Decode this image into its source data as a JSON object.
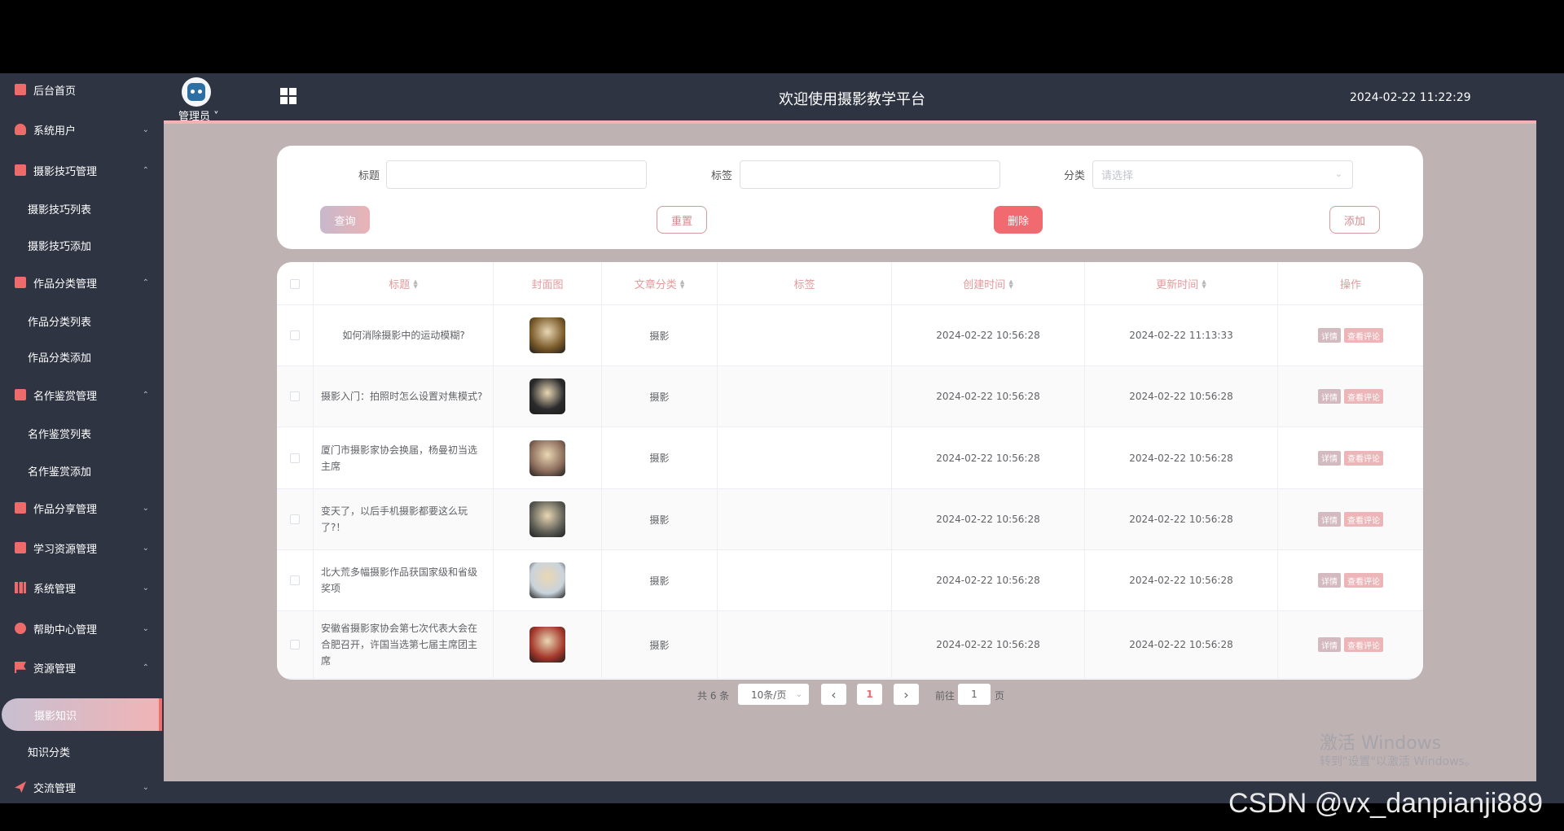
{
  "sidebar": {
    "items": [
      {
        "label": "后台首页",
        "icon": "monitor-icon",
        "chevron": ""
      },
      {
        "label": "系统用户",
        "icon": "user-icon",
        "chevron": "⌄"
      },
      {
        "label": "摄影技巧管理",
        "icon": "chart-icon",
        "chevron": "⌃"
      },
      {
        "label": "摄影技巧列表"
      },
      {
        "label": "摄影技巧添加"
      },
      {
        "label": "作品分类管理",
        "icon": "chart-icon",
        "chevron": "⌃"
      },
      {
        "label": "作品分类列表"
      },
      {
        "label": "作品分类添加"
      },
      {
        "label": "名作鉴赏管理",
        "icon": "chart-icon",
        "chevron": "⌃"
      },
      {
        "label": "名作鉴赏列表"
      },
      {
        "label": "名作鉴赏添加"
      },
      {
        "label": "作品分享管理",
        "icon": "chart-icon",
        "chevron": "⌄"
      },
      {
        "label": "学习资源管理",
        "icon": "chart-icon",
        "chevron": "⌄"
      },
      {
        "label": "系统管理",
        "icon": "bar-chart-icon",
        "chevron": "⌄"
      },
      {
        "label": "帮助中心管理",
        "icon": "info-icon",
        "chevron": "⌄"
      },
      {
        "label": "资源管理",
        "icon": "flag-icon",
        "chevron": "⌃"
      },
      {
        "label": "摄影知识"
      },
      {
        "label": "知识分类"
      },
      {
        "label": "交流管理",
        "icon": "send-icon",
        "chevron": "⌄"
      }
    ]
  },
  "topbar": {
    "admin": "管理员 ˅",
    "title": "欢迎使用摄影教学平台",
    "datetime": "2024-02-22 11:22:29"
  },
  "search": {
    "title_label": "标题",
    "tag_label": "标签",
    "category_label": "分类",
    "category_placeholder": "请选择",
    "query_btn": "查询",
    "reset_btn": "重置",
    "delete_btn": "删除",
    "add_btn": "添加"
  },
  "table": {
    "headers": [
      "标题",
      "封面图",
      "文章分类",
      "标签",
      "创建时间",
      "更新时间",
      "操作"
    ],
    "detail_btn": "详情",
    "comment_btn": "查看评论",
    "rows": [
      {
        "title": "如何消除摄影中的运动模糊?",
        "category": "摄影",
        "tag": "",
        "created": "2024-02-22 10:56:28",
        "updated": "2024-02-22 11:13:33",
        "thumb": "#7a5a2a"
      },
      {
        "title": "摄影入门：拍照时怎么设置对焦模式?",
        "category": "摄影",
        "tag": "",
        "created": "2024-02-22 10:56:28",
        "updated": "2024-02-22 10:56:28",
        "thumb": "#2b2b2d"
      },
      {
        "title": "厦门市摄影家协会换届，杨曼初当选主席",
        "category": "摄影",
        "tag": "",
        "created": "2024-02-22 10:56:28",
        "updated": "2024-02-22 10:56:28",
        "thumb": "#8c6c5c"
      },
      {
        "title": "变天了，以后手机摄影都要这么玩了?！",
        "category": "摄影",
        "tag": "",
        "created": "2024-02-22 10:56:28",
        "updated": "2024-02-22 10:56:28",
        "thumb": "#5e5e56"
      },
      {
        "title": "北大荒多幅摄影作品获国家级和省级奖项",
        "category": "摄影",
        "tag": "",
        "created": "2024-02-22 10:56:28",
        "updated": "2024-02-22 10:56:28",
        "thumb": "#c9d3dc"
      },
      {
        "title": "安徽省摄影家协会第七次代表大会在合肥召开，许国当选第七届主席团主席",
        "category": "摄影",
        "tag": "",
        "created": "2024-02-22 10:56:28",
        "updated": "2024-02-22 10:56:28",
        "thumb": "#a4382c"
      }
    ]
  },
  "pagination": {
    "total": "共 6 条",
    "page_size": "10条/页",
    "prev": "‹",
    "current": "1",
    "next": "›",
    "goto_prefix": "前往",
    "goto_value": "1",
    "goto_suffix": "页"
  },
  "overlay": {
    "activate_title": "激活 Windows",
    "activate_sub": "转到\"设置\"以激活 Windows。",
    "csdn": "CSDN @vx_danpianji889"
  },
  "colors": {
    "accent": "#f06a6f",
    "header_text": "#e39a9c",
    "sidebar_bg": "#2f3442",
    "content_bg": "#bfb2b3"
  }
}
